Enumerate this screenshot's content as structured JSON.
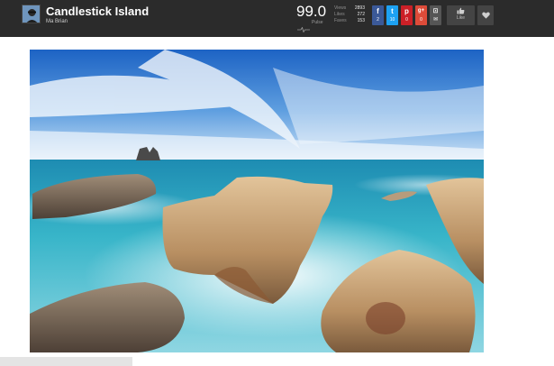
{
  "header": {
    "title": "Candlestick Island",
    "author": "Ma Brian"
  },
  "pulse": {
    "value": "99.0",
    "label": "Pulse"
  },
  "stats": [
    {
      "label": "Views",
      "value": "2893"
    },
    {
      "label": "Likes",
      "value": "272"
    },
    {
      "label": "Faves",
      "value": "153"
    }
  ],
  "shares": [
    {
      "network": "facebook",
      "glyph": "f",
      "count": "2",
      "color": "#3b5998"
    },
    {
      "network": "twitter",
      "glyph": "t",
      "count": "10",
      "color": "#1da1f2"
    },
    {
      "network": "pinterest",
      "glyph": "p",
      "count": "0",
      "color": "#cb2027"
    },
    {
      "network": "google-plus",
      "glyph": "g+",
      "count": "0",
      "color": "#dd4b39"
    },
    {
      "network": "save",
      "glyph": "⊡",
      "count": "✉",
      "color": "#555555"
    }
  ],
  "actions": {
    "like_label": "Like"
  },
  "colors": {
    "topbar": "#2b2b2b",
    "page_bg": "#ffffff"
  },
  "icons": {
    "avatar": "avatar-image",
    "pulse": "pulse-icon",
    "like": "thumbs-up-icon",
    "fave": "heart-icon"
  }
}
